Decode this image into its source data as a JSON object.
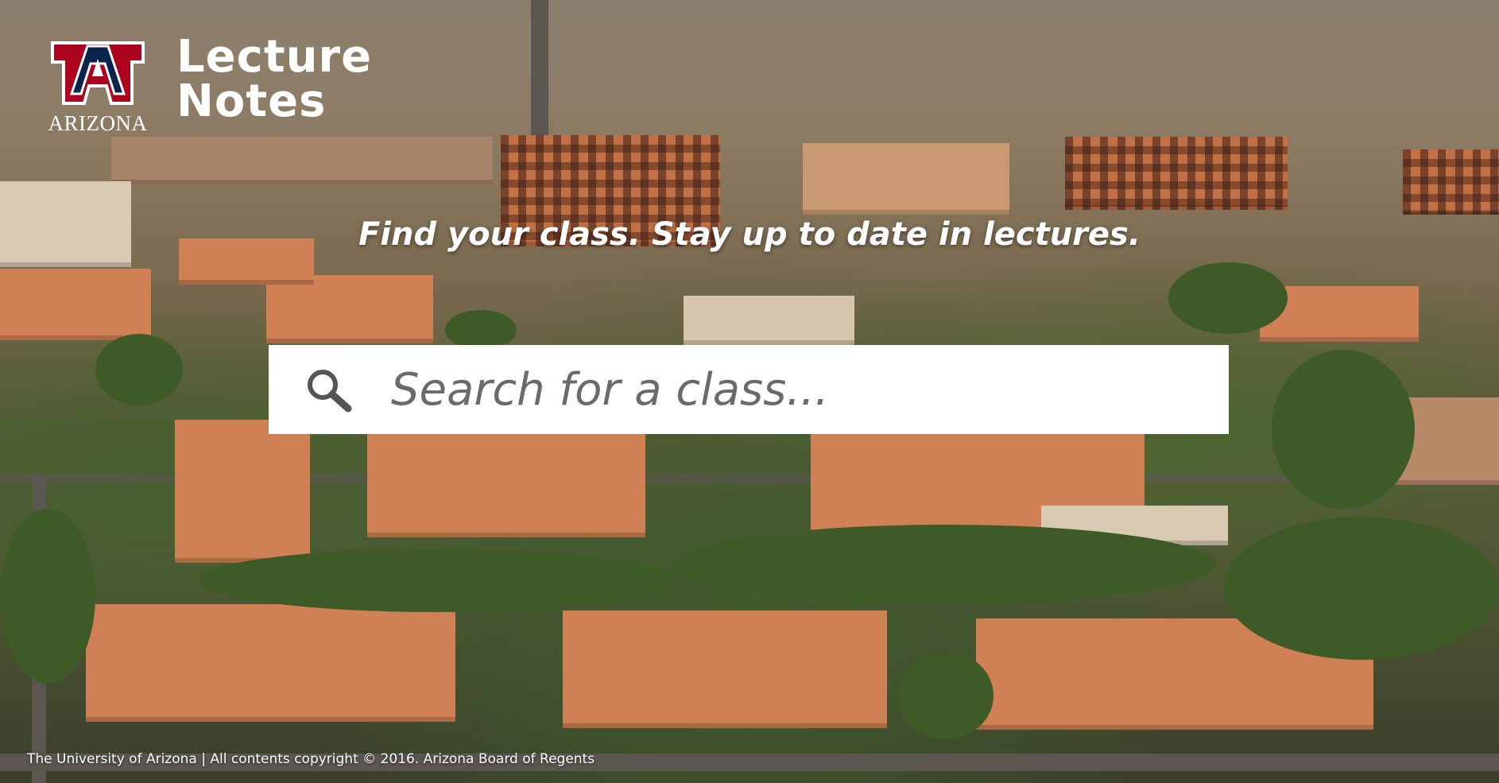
{
  "brand": {
    "logo_letter": "A",
    "logo_wordmark": "ARIZONA",
    "primary_color": "#0c234b",
    "accent_color": "#ab0520"
  },
  "app": {
    "title_line1": "Lecture",
    "title_line2": "Notes"
  },
  "tagline": "Find your class. Stay up to date in lectures.",
  "search": {
    "placeholder": "Search for a class...",
    "value": "",
    "icon": "search-icon"
  },
  "footer": {
    "text": "The University of Arizona | All contents copyright © 2016. Arizona Board of Regents"
  }
}
